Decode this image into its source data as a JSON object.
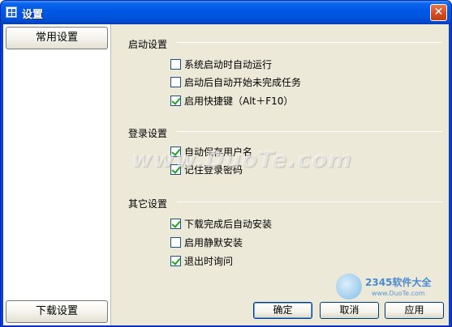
{
  "window": {
    "title": "设置",
    "close_glyph": "✕"
  },
  "sidebar": {
    "items": [
      {
        "label": "常用设置"
      },
      {
        "label": "下载设置"
      }
    ]
  },
  "sections": {
    "startup": {
      "title": "启动设置",
      "options": [
        {
          "label": "系统启动时自动运行",
          "checked": false
        },
        {
          "label": "启动后自动开始未完成任务",
          "checked": false
        },
        {
          "label": "启用快捷键（Alt＋F10）",
          "checked": true
        }
      ]
    },
    "login": {
      "title": "登录设置",
      "options": [
        {
          "label": "自动保存用户名",
          "checked": true
        },
        {
          "label": "记住登录密码",
          "checked": true
        }
      ]
    },
    "other": {
      "title": "其它设置",
      "options": [
        {
          "label": "下载完成后自动安装",
          "checked": true
        },
        {
          "label": "启用静默安装",
          "checked": false
        },
        {
          "label": "退出时询问",
          "checked": true
        }
      ]
    }
  },
  "buttons": {
    "ok": "确定",
    "cancel": "取消",
    "apply": "应用"
  },
  "watermark": {
    "text": "www.DuoTe.com",
    "brand": "2345软件大全",
    "url": "www.DuoTe.com",
    "tagline": "国内最安全的软件站"
  }
}
